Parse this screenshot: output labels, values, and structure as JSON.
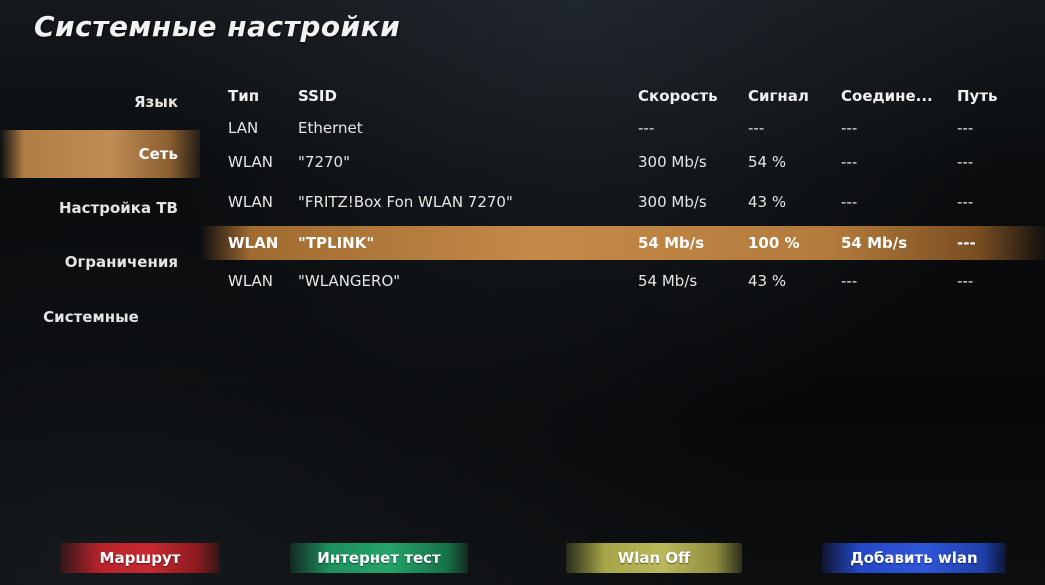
{
  "title": "Системные настройки",
  "sidebar": {
    "items": [
      {
        "label": "Язык"
      },
      {
        "label": "Сеть"
      },
      {
        "label": "Настройка ТВ"
      },
      {
        "label": "Ограничения"
      },
      {
        "label": "Системные"
      }
    ]
  },
  "table": {
    "columns": [
      "Тип",
      "SSID",
      "Скорость",
      "Сигнал",
      "Соедине...",
      "Путь"
    ],
    "rows": [
      {
        "type": "LAN",
        "ssid": "Ethernet",
        "speed": "---",
        "signal": "---",
        "connection": "---",
        "path": "---"
      },
      {
        "type": "WLAN",
        "ssid": "\"7270\"",
        "speed": "300 Mb/s",
        "signal": "54 %",
        "connection": "---",
        "path": "---"
      },
      {
        "type": "WLAN",
        "ssid": "\"FRITZ!Box Fon WLAN 7270\"",
        "speed": "300 Mb/s",
        "signal": "43 %",
        "connection": "---",
        "path": "---"
      },
      {
        "type": "WLAN",
        "ssid": "\"TPLINK\"",
        "speed": "54 Mb/s",
        "signal": "100 %",
        "connection": "54 Mb/s",
        "path": "---"
      },
      {
        "type": "WLAN",
        "ssid": "\"WLANGERO\"",
        "speed": "54 Mb/s",
        "signal": "43 %",
        "connection": "---",
        "path": "---"
      }
    ]
  },
  "buttons": {
    "red": "Маршрут",
    "green": "Интернет тест",
    "yellow": "Wlan Off",
    "blue": "Добавить wlan"
  },
  "colors": {
    "highlight": "#c08d55",
    "red": "#c72a30",
    "green": "#25a36a",
    "yellow": "#bab85a",
    "blue": "#2f56d8"
  }
}
